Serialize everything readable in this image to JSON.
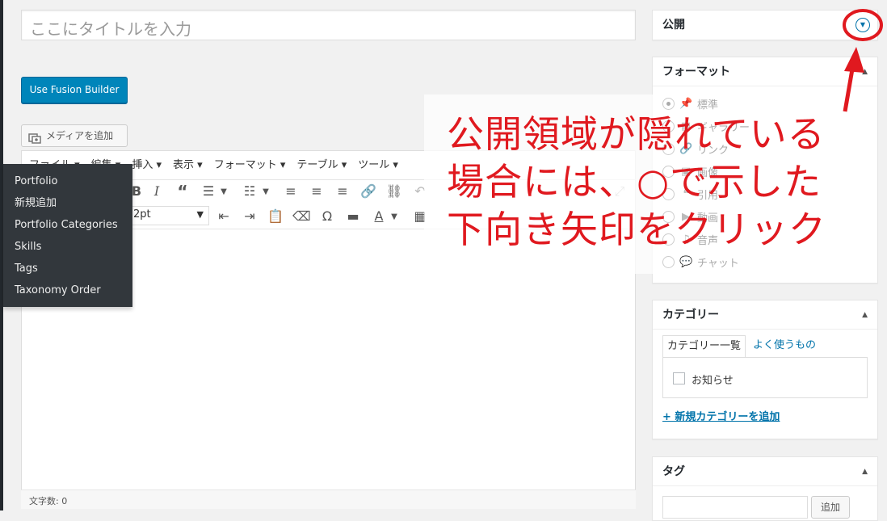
{
  "title_placeholder": "ここにタイトルを入力",
  "fusion_button": "Use Fusion Builder",
  "media_button": "メディアを追加",
  "menubar": [
    {
      "label": "ファイル ▾"
    },
    {
      "label": "編集 ▾"
    },
    {
      "label": "挿入 ▾"
    },
    {
      "label": "表示 ▾"
    },
    {
      "label": "フォーマット ▾"
    },
    {
      "label": "テーブル ▾"
    },
    {
      "label": "ツール ▾"
    }
  ],
  "font_size_value": "2pt",
  "word_count": "文字数: 0",
  "dropdown_menu": [
    {
      "label": "Portfolio"
    },
    {
      "label": "新規追加"
    },
    {
      "label": "Portfolio Categories"
    },
    {
      "label": "Skills"
    },
    {
      "label": "Tags"
    },
    {
      "label": "Taxonomy Order"
    }
  ],
  "publish_panel": {
    "title": "公開"
  },
  "format_panel": {
    "title": "フォーマット",
    "options": [
      {
        "label": "標準",
        "icon": "pin-icon",
        "selected": true
      },
      {
        "label": "ギャラリー",
        "icon": "gallery-icon",
        "selected": false
      },
      {
        "label": "リンク",
        "icon": "link-icon",
        "selected": false
      },
      {
        "label": "画像",
        "icon": "image-icon",
        "selected": false
      },
      {
        "label": "引用",
        "icon": "quote-icon",
        "selected": false
      },
      {
        "label": "動画",
        "icon": "video-icon",
        "selected": false
      },
      {
        "label": "音声",
        "icon": "audio-icon",
        "selected": false
      },
      {
        "label": "チャット",
        "icon": "chat-icon",
        "selected": false
      }
    ]
  },
  "category_panel": {
    "title": "カテゴリー",
    "tab_all": "カテゴリー一覧",
    "tab_popular": "よく使うもの",
    "categories": [
      {
        "label": "お知らせ",
        "checked": false
      }
    ],
    "add_link": "+ 新規カテゴリーを追加"
  },
  "tag_panel": {
    "title": "タグ",
    "add_button": "追加"
  },
  "annotation": {
    "line1": "公開領域が隠れている",
    "line2": "場合には、○で示した",
    "line3": "下向き矢印をクリック",
    "color": "#e0191f"
  },
  "colors": {
    "accent": "#0085ba",
    "link": "#0073aa",
    "menu_bg": "#32373c"
  }
}
